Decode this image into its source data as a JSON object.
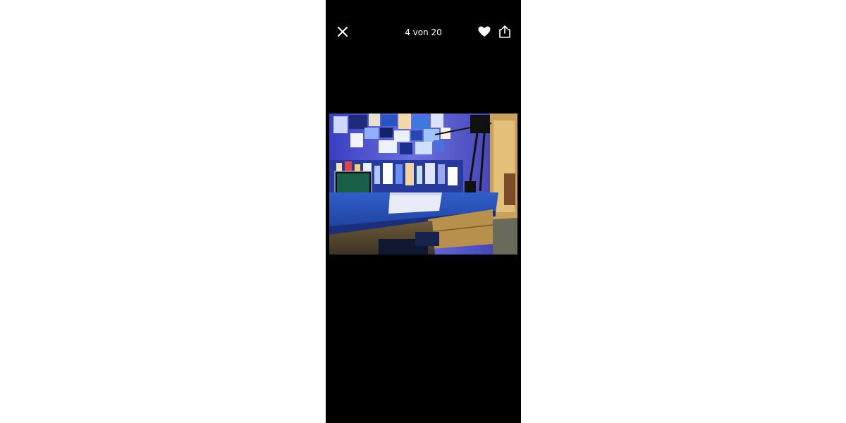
{
  "viewer": {
    "counter": "4 von 20"
  },
  "icons": {
    "close": "close-icon",
    "favorite": "heart-icon",
    "share": "share-icon"
  },
  "photo": {
    "subject": "desk-photo"
  },
  "colors": {
    "background": "#000000",
    "foreground": "#ffffff",
    "page": "#ffffff"
  }
}
